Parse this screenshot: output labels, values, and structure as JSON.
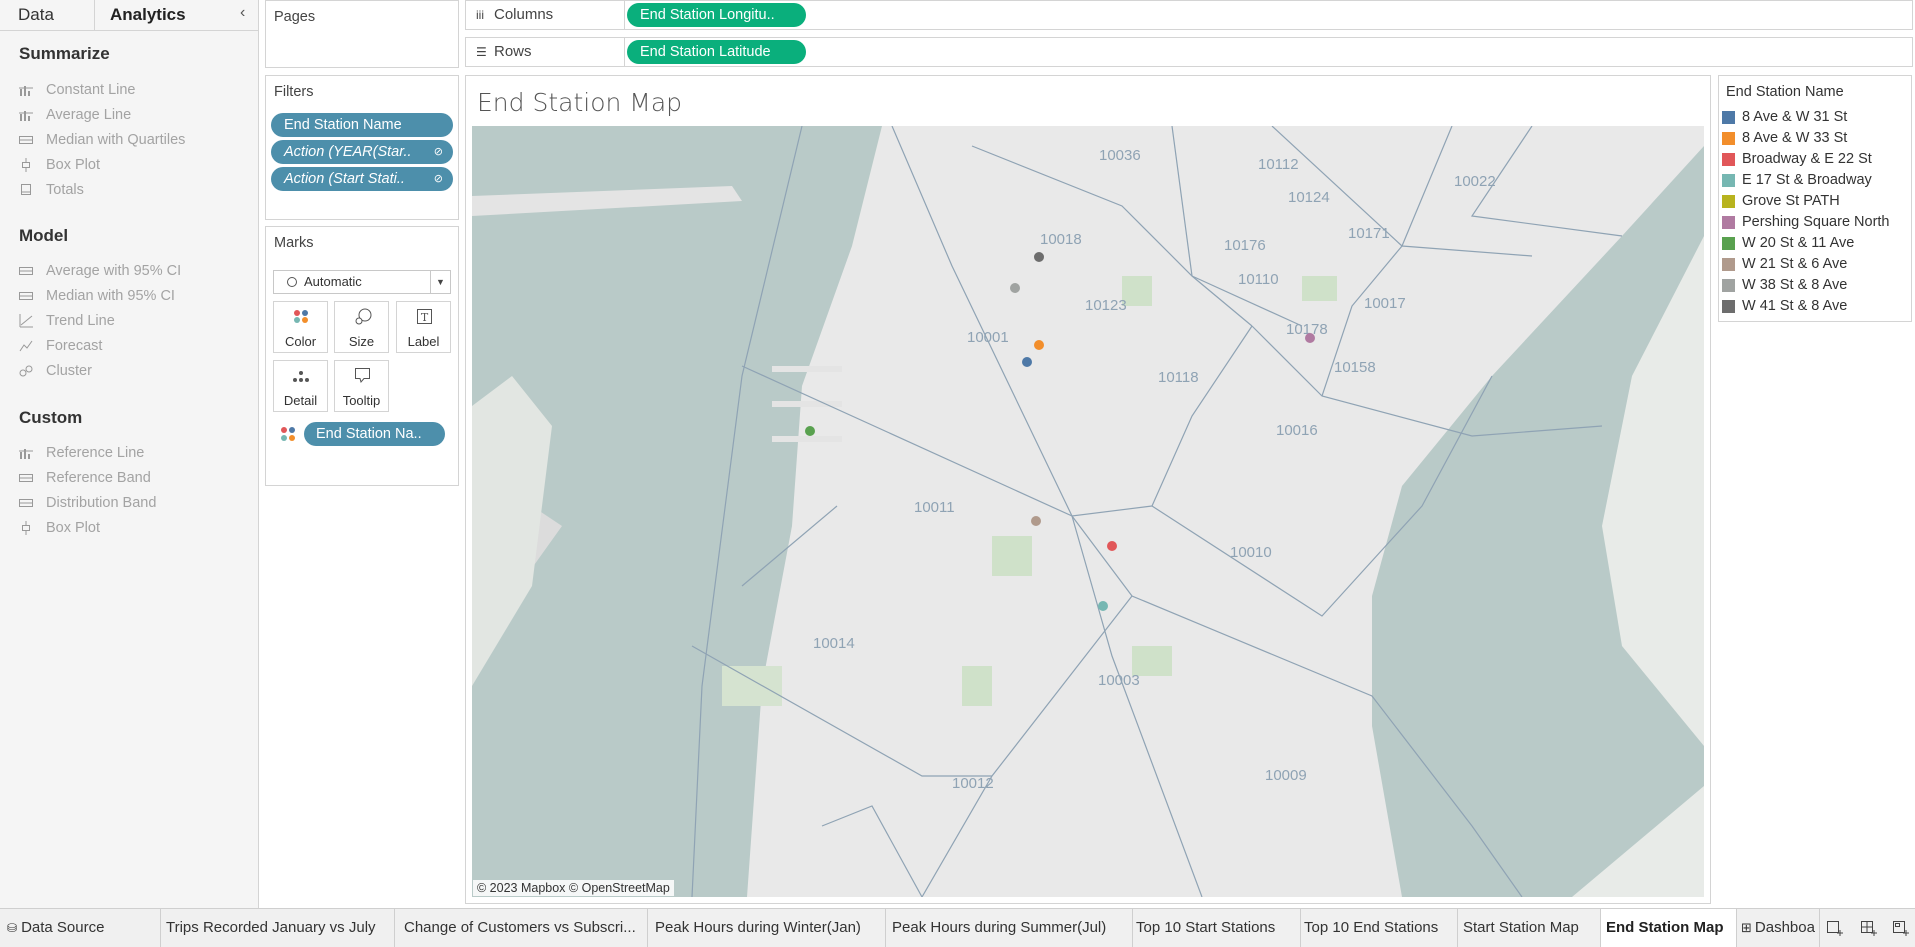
{
  "left_pane": {
    "tabs": [
      "Data",
      "Analytics"
    ],
    "collapse_icon": "chevron-left-icon",
    "summarize": {
      "title": "Summarize",
      "items": [
        "Constant Line",
        "Average Line",
        "Median with Quartiles",
        "Box Plot",
        "Totals"
      ]
    },
    "model": {
      "title": "Model",
      "items": [
        "Average with 95% CI",
        "Median with 95% CI",
        "Trend Line",
        "Forecast",
        "Cluster"
      ]
    },
    "custom": {
      "title": "Custom",
      "items": [
        "Reference Line",
        "Reference Band",
        "Distribution Band",
        "Box Plot"
      ]
    }
  },
  "pages": {
    "title": "Pages"
  },
  "filters": {
    "title": "Filters",
    "pills": [
      "End Station Name",
      "Action (YEAR(Star..",
      "Action (Start Stati.."
    ]
  },
  "marks": {
    "title": "Marks",
    "mark_type": "Automatic",
    "buttons": [
      "Color",
      "Size",
      "Label",
      "Detail",
      "Tooltip"
    ],
    "color_pill": "End Station Na.."
  },
  "shelves": {
    "columns_label": "Columns",
    "columns_pill": "End Station Longitu..",
    "rows_label": "Rows",
    "rows_pill": "End Station Latitude"
  },
  "viz": {
    "title": "End Station Map",
    "credit": "© 2023 Mapbox © OpenStreetMap",
    "zip_labels": [
      "10036",
      "10112",
      "10124",
      "10022",
      "10018",
      "10176",
      "10171",
      "10110",
      "10123",
      "10017",
      "10001",
      "10178",
      "10158",
      "10118",
      "10016",
      "10011",
      "10010",
      "10014",
      "10003",
      "10012",
      "10009"
    ]
  },
  "legend": {
    "title": "End Station Name",
    "items": [
      {
        "name": "8 Ave & W 31 St",
        "color": "#4e79a7"
      },
      {
        "name": "8 Ave & W 33 St",
        "color": "#f28e2b"
      },
      {
        "name": "Broadway & E 22 St",
        "color": "#e15759"
      },
      {
        "name": "E 17 St & Broadway",
        "color": "#76b7b2"
      },
      {
        "name": "Grove St PATH",
        "color": "#b8b31e"
      },
      {
        "name": "Pershing Square North",
        "color": "#b07aa1"
      },
      {
        "name": "W 20 St & 11 Ave",
        "color": "#59a14f"
      },
      {
        "name": "W 21 St & 6 Ave",
        "color": "#b09a8c"
      },
      {
        "name": "W 38 St & 8 Ave",
        "color": "#a0a3a1"
      },
      {
        "name": "W 41 St & 8 Ave",
        "color": "#6d6d6d"
      }
    ]
  },
  "sheet_tabs": {
    "items": [
      "Data Source",
      "Trips Recorded January vs July",
      "Change of Customers vs Subscri...",
      "Peak Hours during Winter(Jan)",
      "Peak Hours during Summer(Jul)",
      "Top 10 Start Stations",
      "Top 10 End Stations",
      "Start Station Map",
      "End Station Map",
      "Dashboa"
    ],
    "active": "End Station Map"
  }
}
